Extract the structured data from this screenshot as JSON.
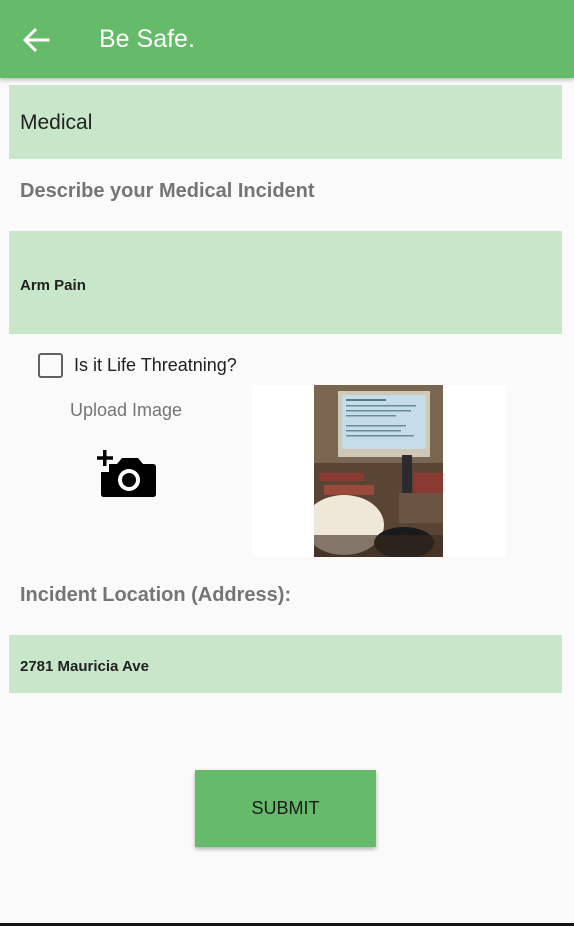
{
  "app_bar": {
    "title": "Be Safe.",
    "back_icon": "arrow-left-icon",
    "color": "#66bb6a"
  },
  "incident_type": {
    "value": "Medical"
  },
  "description": {
    "label": "Describe your Medical Incident",
    "value": "Arm Pain"
  },
  "life_threatening": {
    "label": "Is it Life Threatning?",
    "checked": false
  },
  "upload": {
    "label": "Upload Image",
    "icon": "add-photo-icon"
  },
  "location": {
    "label": "Incident Location (Address):",
    "value": "2781 Mauricia Ave"
  },
  "submit": {
    "label": "SUBMIT"
  },
  "colors": {
    "field_background": "#c8e6c9",
    "accent": "#66bb6a"
  }
}
